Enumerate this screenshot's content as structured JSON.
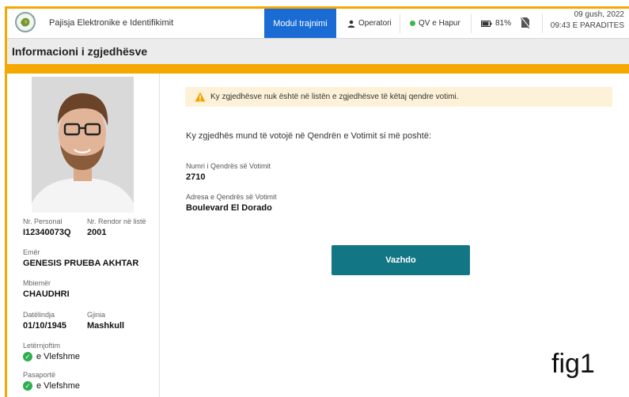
{
  "header": {
    "app_title": "Pajisja Elektronike e Identifikimit",
    "nav_active": "Modul trajnimi",
    "operator_label": "Operatori",
    "status_label": "QV e Hapur",
    "battery_label": "81%",
    "date": "09 gush, 2022",
    "time": "09:43 E PARADITES"
  },
  "page": {
    "title": "Informacioni i zgjedhësve"
  },
  "voter": {
    "personal_no_label": "Nr. Personal",
    "personal_no": "I12340073Q",
    "list_order_label": "Nr. Rendor në listë",
    "list_order": "2001",
    "name_label": "Emër",
    "name": "GENESIS PRUEBA AKHTAR",
    "surname_label": "Mbiemër",
    "surname": "CHAUDHRI",
    "dob_label": "Datëlindja",
    "dob": "01/10/1945",
    "gender_label": "Gjinia",
    "gender": "Mashkull",
    "id_card_label": "Letërnjoftim",
    "id_card_status": "e Vlefshme",
    "passport_label": "Pasaportë",
    "passport_status": "e Vlefshme"
  },
  "main": {
    "warning": "Ky zgjedhësve nuk është në listën e zgjedhësve të këtaj qendre votimi.",
    "intro": "Ky zgjedhës mund të votojë në Qendrën e Votimit si më poshtë:",
    "center_no_label": "Numri i Qendrës së Votimit",
    "center_no": "2710",
    "center_address_label": "Adresa e Qendrës së Votimit",
    "center_address": "Boulevard El Dorado",
    "continue_button": "Vazhdo"
  },
  "figure_label": "fig1",
  "colors": {
    "accent_orange": "#f5a800",
    "nav_blue": "#1a6bd4",
    "button_teal": "#137684",
    "valid_green": "#2fae4e",
    "warning_bg": "#fdf2d8"
  }
}
